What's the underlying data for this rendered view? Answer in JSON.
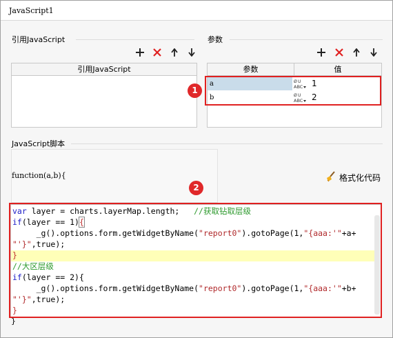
{
  "window": {
    "title": "JavaScript1"
  },
  "js_section": {
    "label": "引用JavaScript",
    "column_header": "引用JavaScript"
  },
  "params_section": {
    "label": "参数",
    "headers": [
      "参数",
      "值"
    ],
    "rows": [
      {
        "name": "a",
        "value": "1"
      },
      {
        "name": "b",
        "value": "2"
      }
    ]
  },
  "toolbar_icons": [
    "add-icon",
    "delete-icon",
    "move-up-icon",
    "move-down-icon"
  ],
  "script_section": {
    "label": "JavaScript脚本",
    "signature": "function(a,b){",
    "format_button": "格式化代码",
    "closing": "}",
    "code": {
      "l1_kw": "var",
      "l1_a": " layer = charts.layerMap.length;   ",
      "l1_cm": "//获取钻取层级",
      "l2_kw": "if",
      "l2_a": "(layer == 1)",
      "l2_br": "{",
      "l3_a": "     _g().options.form.getWidgetByName(",
      "l3_s1": "\"report0\"",
      "l3_b": ").gotoPage(1,",
      "l3_s2": "\"{aaa:'\"",
      "l3_c": "+a+",
      "l4_s": "\"'}\"",
      "l4_a": ",true);",
      "l5": "}",
      "l6": "//大区层级",
      "l7_kw": "if",
      "l7_a": "(layer == 2){",
      "l8_a": "     _g().options.form.getWidgetByName(",
      "l8_s1": "\"report0\"",
      "l8_b": ").gotoPage(1,",
      "l8_s2": "\"{aaa:'\"",
      "l8_c": "+b+",
      "l9_s": "\"'}\"",
      "l9_a": ",true);",
      "l10": "}"
    }
  },
  "badges": [
    "1",
    "2"
  ],
  "colors": {
    "highlight_red": "#e02020",
    "selected_cell": "#c9dcea",
    "current_line": "#ffffb8"
  }
}
